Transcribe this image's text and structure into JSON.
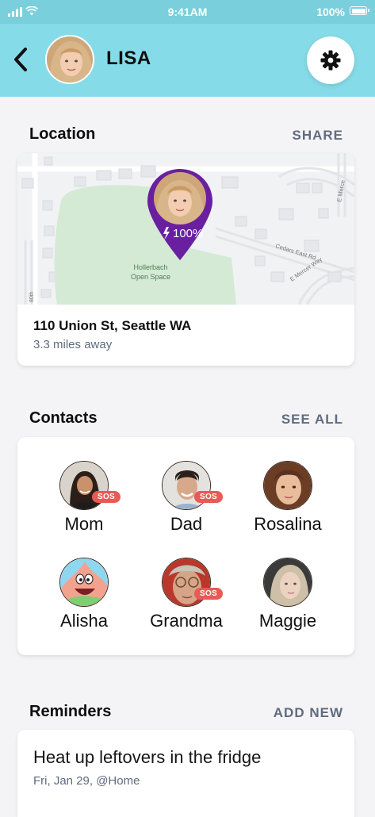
{
  "status_bar": {
    "time": "9:41AM",
    "battery": "100%"
  },
  "header": {
    "name": "LISA"
  },
  "location": {
    "title": "Location",
    "action": "SHARE",
    "map": {
      "park_name_line1": "Hollerbach",
      "park_name_line2": "Open Space",
      "street_1": "Cedars East Rd",
      "street_2": "E Mercer Way",
      "street_3": "E Merce",
      "street_4": "80th",
      "pin_battery": "100%"
    },
    "address": "110 Union St, Seattle WA",
    "distance": "3.3 miles away"
  },
  "contacts": {
    "title": "Contacts",
    "action": "SEE ALL",
    "sos_label": "SOS",
    "items": [
      {
        "name": "Mom",
        "sos": true
      },
      {
        "name": "Dad",
        "sos": true
      },
      {
        "name": "Rosalina",
        "sos": false
      },
      {
        "name": "Alisha",
        "sos": false
      },
      {
        "name": "Grandma",
        "sos": true
      },
      {
        "name": "Maggie",
        "sos": false
      }
    ]
  },
  "reminders": {
    "title": "Reminders",
    "action": "ADD NEW",
    "items": [
      {
        "text": "Heat up leftovers in the fridge",
        "meta": "Fri, Jan 29, @Home"
      }
    ]
  },
  "colors": {
    "header_bg": "#86dbe8",
    "pin_purple": "#6a1fa0",
    "sos_red": "#e85a55",
    "muted_text": "#5f6b7e",
    "park_green": "#d4ead5"
  }
}
